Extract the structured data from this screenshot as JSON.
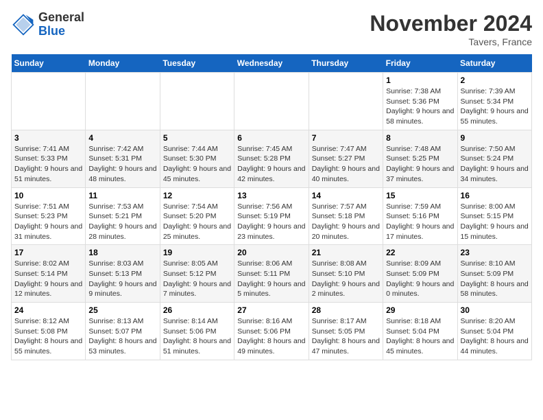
{
  "header": {
    "logo_general": "General",
    "logo_blue": "Blue",
    "month_title": "November 2024",
    "location": "Tavers, France"
  },
  "days_of_week": [
    "Sunday",
    "Monday",
    "Tuesday",
    "Wednesday",
    "Thursday",
    "Friday",
    "Saturday"
  ],
  "weeks": [
    [
      {
        "day": "",
        "info": ""
      },
      {
        "day": "",
        "info": ""
      },
      {
        "day": "",
        "info": ""
      },
      {
        "day": "",
        "info": ""
      },
      {
        "day": "",
        "info": ""
      },
      {
        "day": "1",
        "info": "Sunrise: 7:38 AM\nSunset: 5:36 PM\nDaylight: 9 hours and 58 minutes."
      },
      {
        "day": "2",
        "info": "Sunrise: 7:39 AM\nSunset: 5:34 PM\nDaylight: 9 hours and 55 minutes."
      }
    ],
    [
      {
        "day": "3",
        "info": "Sunrise: 7:41 AM\nSunset: 5:33 PM\nDaylight: 9 hours and 51 minutes."
      },
      {
        "day": "4",
        "info": "Sunrise: 7:42 AM\nSunset: 5:31 PM\nDaylight: 9 hours and 48 minutes."
      },
      {
        "day": "5",
        "info": "Sunrise: 7:44 AM\nSunset: 5:30 PM\nDaylight: 9 hours and 45 minutes."
      },
      {
        "day": "6",
        "info": "Sunrise: 7:45 AM\nSunset: 5:28 PM\nDaylight: 9 hours and 42 minutes."
      },
      {
        "day": "7",
        "info": "Sunrise: 7:47 AM\nSunset: 5:27 PM\nDaylight: 9 hours and 40 minutes."
      },
      {
        "day": "8",
        "info": "Sunrise: 7:48 AM\nSunset: 5:25 PM\nDaylight: 9 hours and 37 minutes."
      },
      {
        "day": "9",
        "info": "Sunrise: 7:50 AM\nSunset: 5:24 PM\nDaylight: 9 hours and 34 minutes."
      }
    ],
    [
      {
        "day": "10",
        "info": "Sunrise: 7:51 AM\nSunset: 5:23 PM\nDaylight: 9 hours and 31 minutes."
      },
      {
        "day": "11",
        "info": "Sunrise: 7:53 AM\nSunset: 5:21 PM\nDaylight: 9 hours and 28 minutes."
      },
      {
        "day": "12",
        "info": "Sunrise: 7:54 AM\nSunset: 5:20 PM\nDaylight: 9 hours and 25 minutes."
      },
      {
        "day": "13",
        "info": "Sunrise: 7:56 AM\nSunset: 5:19 PM\nDaylight: 9 hours and 23 minutes."
      },
      {
        "day": "14",
        "info": "Sunrise: 7:57 AM\nSunset: 5:18 PM\nDaylight: 9 hours and 20 minutes."
      },
      {
        "day": "15",
        "info": "Sunrise: 7:59 AM\nSunset: 5:16 PM\nDaylight: 9 hours and 17 minutes."
      },
      {
        "day": "16",
        "info": "Sunrise: 8:00 AM\nSunset: 5:15 PM\nDaylight: 9 hours and 15 minutes."
      }
    ],
    [
      {
        "day": "17",
        "info": "Sunrise: 8:02 AM\nSunset: 5:14 PM\nDaylight: 9 hours and 12 minutes."
      },
      {
        "day": "18",
        "info": "Sunrise: 8:03 AM\nSunset: 5:13 PM\nDaylight: 9 hours and 9 minutes."
      },
      {
        "day": "19",
        "info": "Sunrise: 8:05 AM\nSunset: 5:12 PM\nDaylight: 9 hours and 7 minutes."
      },
      {
        "day": "20",
        "info": "Sunrise: 8:06 AM\nSunset: 5:11 PM\nDaylight: 9 hours and 5 minutes."
      },
      {
        "day": "21",
        "info": "Sunrise: 8:08 AM\nSunset: 5:10 PM\nDaylight: 9 hours and 2 minutes."
      },
      {
        "day": "22",
        "info": "Sunrise: 8:09 AM\nSunset: 5:09 PM\nDaylight: 9 hours and 0 minutes."
      },
      {
        "day": "23",
        "info": "Sunrise: 8:10 AM\nSunset: 5:09 PM\nDaylight: 8 hours and 58 minutes."
      }
    ],
    [
      {
        "day": "24",
        "info": "Sunrise: 8:12 AM\nSunset: 5:08 PM\nDaylight: 8 hours and 55 minutes."
      },
      {
        "day": "25",
        "info": "Sunrise: 8:13 AM\nSunset: 5:07 PM\nDaylight: 8 hours and 53 minutes."
      },
      {
        "day": "26",
        "info": "Sunrise: 8:14 AM\nSunset: 5:06 PM\nDaylight: 8 hours and 51 minutes."
      },
      {
        "day": "27",
        "info": "Sunrise: 8:16 AM\nSunset: 5:06 PM\nDaylight: 8 hours and 49 minutes."
      },
      {
        "day": "28",
        "info": "Sunrise: 8:17 AM\nSunset: 5:05 PM\nDaylight: 8 hours and 47 minutes."
      },
      {
        "day": "29",
        "info": "Sunrise: 8:18 AM\nSunset: 5:04 PM\nDaylight: 8 hours and 45 minutes."
      },
      {
        "day": "30",
        "info": "Sunrise: 8:20 AM\nSunset: 5:04 PM\nDaylight: 8 hours and 44 minutes."
      }
    ]
  ]
}
